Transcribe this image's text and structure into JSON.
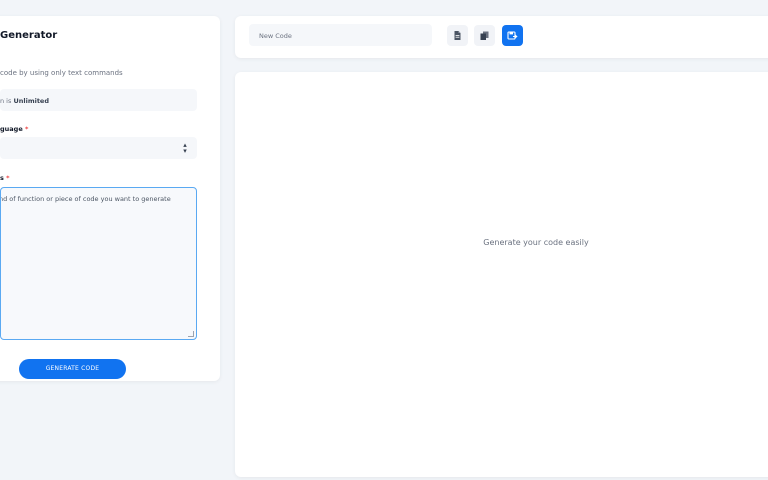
{
  "generator": {
    "title": "Generator",
    "subtitle": "code by using only text commands",
    "usage_prefix": "n is ",
    "usage_value": "Unlimited",
    "language_label": "guage",
    "required_mark": "*",
    "description_label": "s",
    "description_placeholder": "nd of function or piece of code you want to generate",
    "generate_label": "GENERATE CODE"
  },
  "toolbar": {
    "title_value": "New Code",
    "icons": [
      "document-icon",
      "copy-icon",
      "save-icon"
    ]
  },
  "output": {
    "placeholder": "Generate your code easily"
  },
  "colors": {
    "accent": "#1173f0",
    "required": "#ef4444",
    "background": "#f2f5f9",
    "focus_border": "#5aa9f2"
  }
}
